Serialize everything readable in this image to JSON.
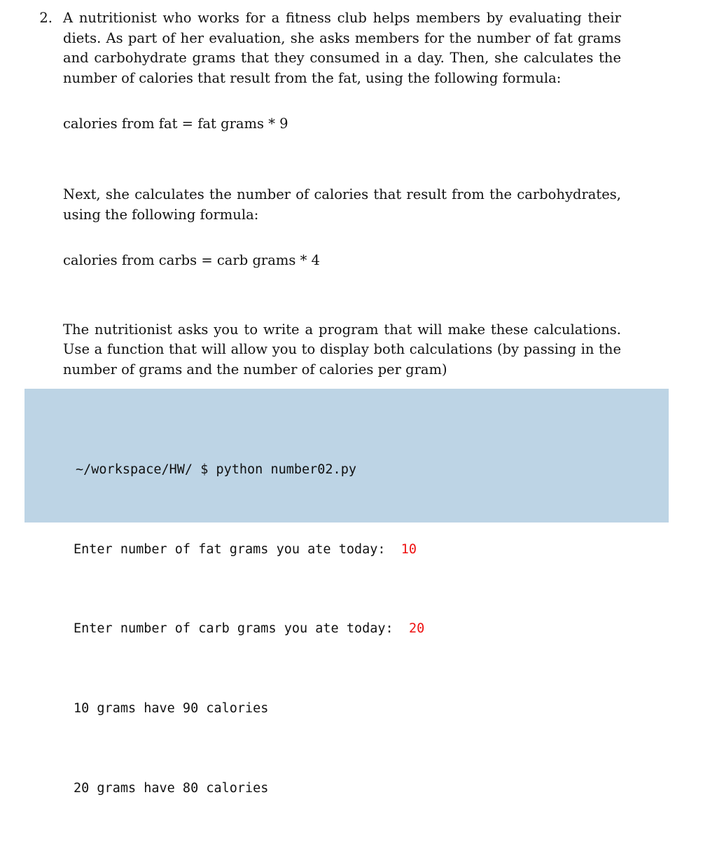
{
  "problem": {
    "marker": "2.",
    "paragraph_1": "A nutritionist who works for a fitness club helps members by evaluating their diets.  As part of her evaluation, she asks members for the number of fat grams and carbohydrate grams that they consumed in a day.  Then, she calculates the number of calories that result from the fat, using the following formula:",
    "formula_1": "calories from fat = fat grams * 9",
    "paragraph_2": "Next, she calculates the number of calories that result from the carbohydrates, using the following formula:",
    "formula_2": "calories from carbs = carb grams * 4",
    "paragraph_3": "The nutritionist asks you to write a program that will make these calculations.  Use a function that will allow you to display both calculations (by passing in the number of grams and the number of calories per gram)"
  },
  "console": {
    "background_color": "#bdd4e5",
    "input_value_color": "#ee1111",
    "prompt": "~/workspace/HW/ $ ",
    "command": "python number02.py",
    "line_2_label": "Enter number of fat grams you ate today:  ",
    "line_2_value": "10",
    "line_3_label": "Enter number of carb grams you ate today:  ",
    "line_3_value": "20",
    "line_4": "10 grams have 90 calories",
    "line_5": "20 grams have 80 calories"
  }
}
